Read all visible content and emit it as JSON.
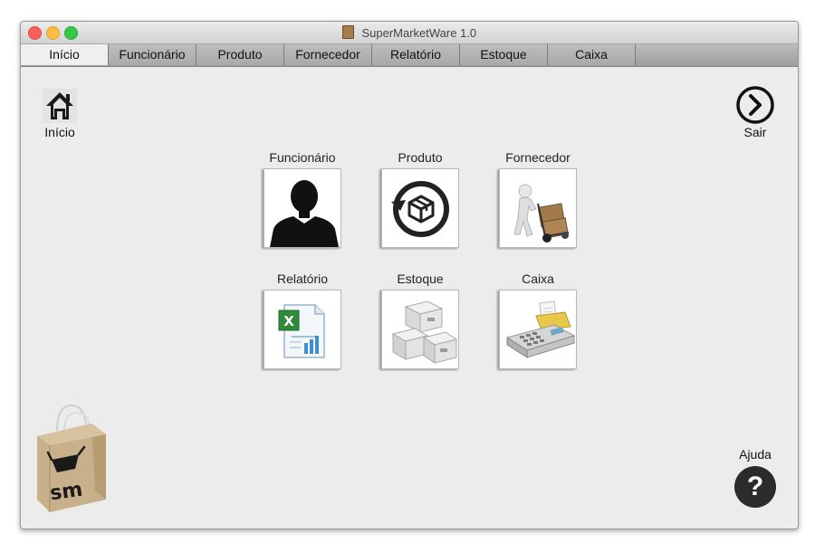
{
  "window": {
    "title": "SuperMarketWare 1.0"
  },
  "tabs": [
    {
      "label": "Início"
    },
    {
      "label": "Funcionário"
    },
    {
      "label": "Produto"
    },
    {
      "label": "Fornecedor"
    },
    {
      "label": "Relatório"
    },
    {
      "label": "Estoque"
    },
    {
      "label": "Caixa"
    }
  ],
  "corners": {
    "home_label": "Início",
    "exit_label": "Sair",
    "help_label": "Ajuda",
    "help_symbol": "?"
  },
  "modules": [
    {
      "label": "Funcionário"
    },
    {
      "label": "Produto"
    },
    {
      "label": "Fornecedor"
    },
    {
      "label": "Relatório"
    },
    {
      "label": "Estoque"
    },
    {
      "label": "Caixa"
    }
  ],
  "logo": {
    "text": "sm"
  },
  "colors": {
    "tab_bar": "#a9a9a9",
    "tab_active": "#efefef",
    "window_bg": "#ececec",
    "help_bg": "#2b2b2b"
  }
}
